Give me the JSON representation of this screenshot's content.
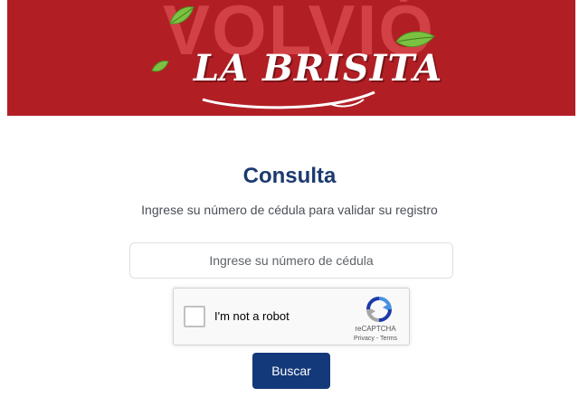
{
  "banner": {
    "background_text": "VOLVIÓ",
    "logo_text": "LA BRISITA",
    "color": "#b11f25"
  },
  "main": {
    "title": "Consulta",
    "subtitle": "Ingrese su número de cédula para validar su registro",
    "id_input": {
      "placeholder": "Ingrese su número de cédula",
      "value": ""
    },
    "captcha": {
      "label": "I'm not a robot",
      "brand": "reCAPTCHA",
      "privacy_link": "Privacy",
      "separator": " - ",
      "terms_link": "Terms",
      "checked": false
    },
    "search_button_label": "Buscar"
  },
  "colors": {
    "title": "#1c3a6e",
    "button": "#14397a",
    "banner": "#b11f25"
  },
  "icons": [
    "leaf-icon",
    "recaptcha-logo-icon",
    "checkbox-icon"
  ]
}
